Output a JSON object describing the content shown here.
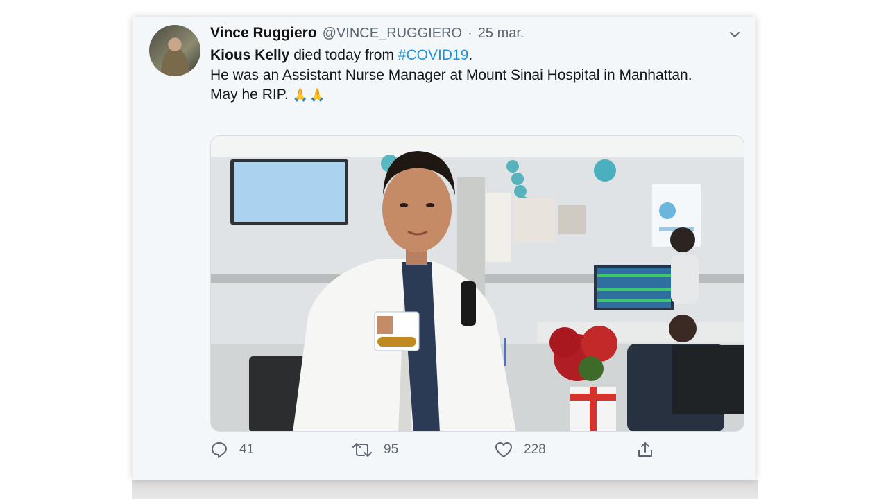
{
  "tweet": {
    "author_name": "Vince Ruggiero",
    "handle": "@VINCE_RUGGIERO",
    "separator": "·",
    "date": "25 mar.",
    "line1_mention": "Kious Kelly",
    "line1_text": " died today from ",
    "line1_hashtag": "#COVID19",
    "line1_end": ".",
    "line2": "He was an Assistant Nurse Manager at Mount Sinai Hospital in Manhattan.",
    "line3": "May he RIP.",
    "emoji": "🙏🙏"
  },
  "actions": {
    "replies": "41",
    "retweets": "95",
    "likes": "228"
  },
  "icons": {
    "more": "chevron-down-icon",
    "reply": "reply-icon",
    "retweet": "retweet-icon",
    "like": "heart-icon",
    "share": "share-icon"
  },
  "colors": {
    "hashtag": "#1b95e0",
    "muted": "#5b6670",
    "card_bg": "#f4f7fa"
  }
}
